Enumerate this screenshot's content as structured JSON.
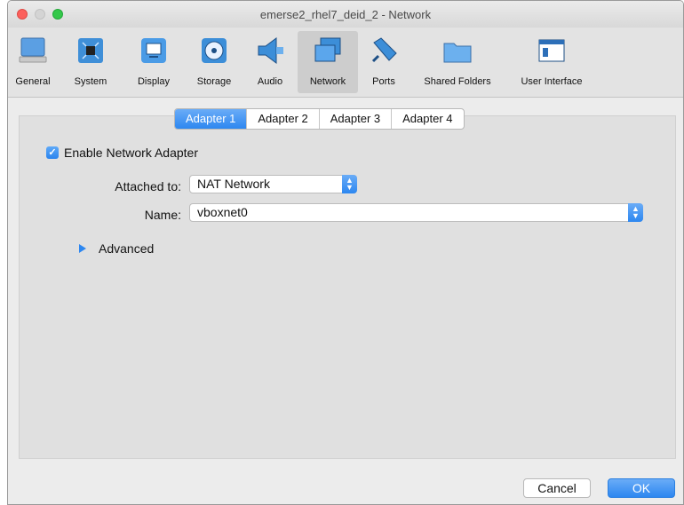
{
  "window": {
    "title": "emerse2_rhel7_deid_2 - Network"
  },
  "toolbar": {
    "items": [
      {
        "label": "General",
        "icon": "general-icon"
      },
      {
        "label": "System",
        "icon": "system-icon"
      },
      {
        "label": "Display",
        "icon": "display-icon"
      },
      {
        "label": "Storage",
        "icon": "storage-icon"
      },
      {
        "label": "Audio",
        "icon": "audio-icon"
      },
      {
        "label": "Network",
        "icon": "network-icon",
        "selected": true
      },
      {
        "label": "Ports",
        "icon": "ports-icon"
      },
      {
        "label": "Shared Folders",
        "icon": "shared-folders-icon"
      },
      {
        "label": "User Interface",
        "icon": "user-interface-icon"
      }
    ]
  },
  "tabs": [
    {
      "label": "Adapter 1",
      "active": true
    },
    {
      "label": "Adapter 2"
    },
    {
      "label": "Adapter 3"
    },
    {
      "label": "Adapter 4"
    }
  ],
  "adapter": {
    "enable_label": "Enable Network Adapter",
    "enabled": true,
    "attached_label": "Attached to:",
    "attached_value": "NAT Network",
    "name_label": "Name:",
    "name_value": "vboxnet0",
    "advanced_label": "Advanced"
  },
  "buttons": {
    "cancel": "Cancel",
    "ok": "OK"
  },
  "colors": {
    "accent": "#2d87f0"
  }
}
